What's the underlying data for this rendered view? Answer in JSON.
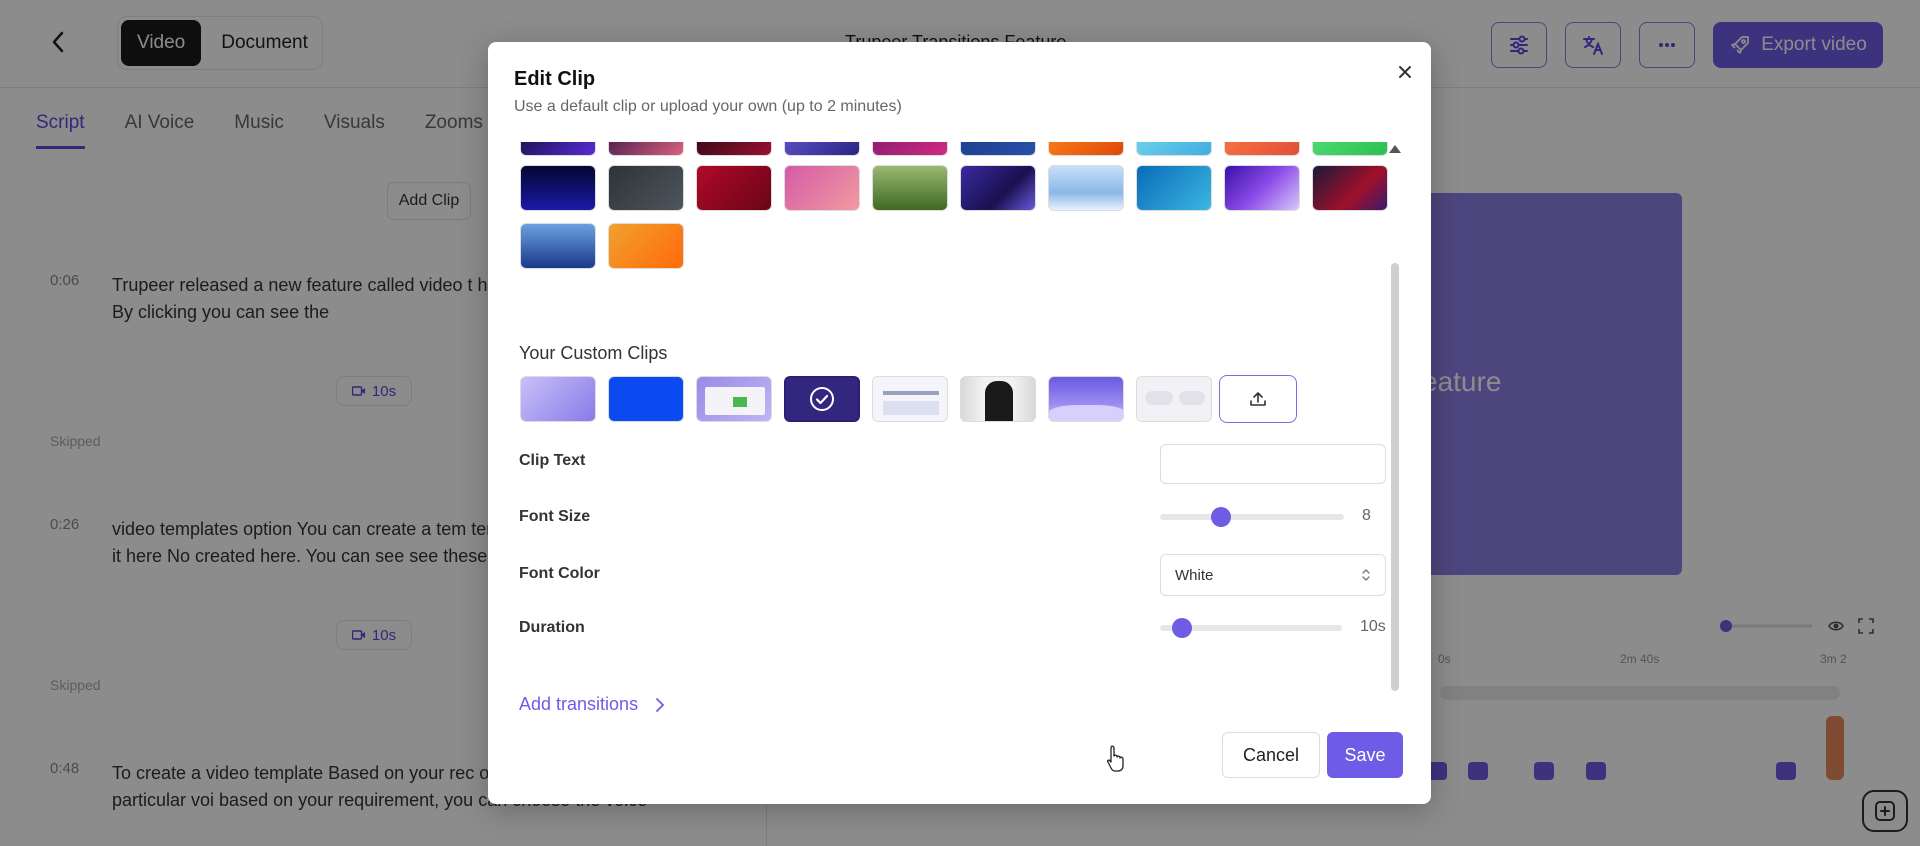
{
  "topbar": {
    "mode_options": [
      "Video",
      "Document"
    ],
    "project_title": "Trupeer Transitions Feature",
    "export_label": "Export video"
  },
  "tabs": [
    "Script",
    "AI Voice",
    "Music",
    "Visuals",
    "Zooms"
  ],
  "add_clip_label": "Add Clip",
  "script": [
    {
      "time": "0:06",
      "text": "Trupeer released a new feature called video t how to use those video templates  By clicking you can see the",
      "duration": "10s"
    },
    {
      "time": "0:26",
      "text": "video templates option  You can create a tem template option. Once you click on it here  No created here. You can see see these several o",
      "duration": "10s"
    },
    {
      "time": "0:48",
      "text": "To create a video template  Based on your rec one by one. You can choose the particular voi based on your requirement, you can choose the voice"
    }
  ],
  "skipped_label": "Skipped",
  "preview_text": "eature",
  "timeline": {
    "labels": [
      "0s",
      "2m 40s",
      "3m 2"
    ]
  },
  "modal": {
    "title": "Edit Clip",
    "subtitle": "Use a default clip or upload your own (up to 2 minutes)",
    "custom_clips_label": "Your Custom Clips",
    "clip_text_label": "Clip Text",
    "clip_text_value": "",
    "font_size_label": "Font Size",
    "font_size_value": "8",
    "font_size_level": 0.33,
    "font_color_label": "Font Color",
    "font_color_value": "White",
    "duration_label": "Duration",
    "duration_value": "10s",
    "duration_level": 0.12,
    "add_transitions_label": "Add transitions",
    "cancel_label": "Cancel",
    "save_label": "Save"
  },
  "colors": {
    "accent": "#6f5ce6",
    "accent_dark": "#5b47dc"
  }
}
